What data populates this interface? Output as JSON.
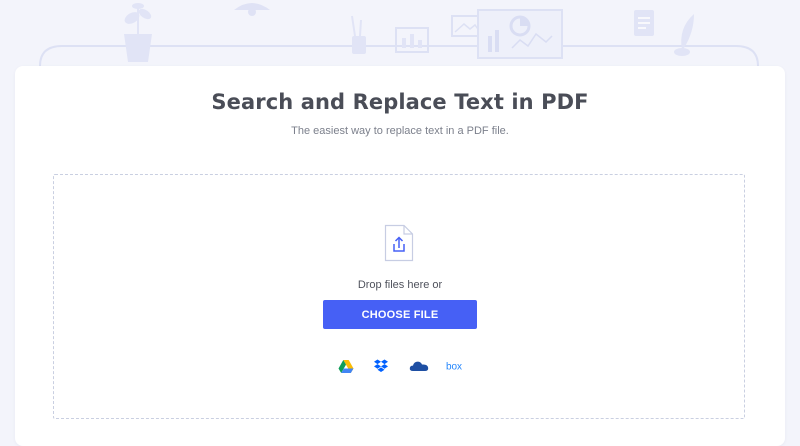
{
  "page": {
    "title": "Search and Replace Text in PDF",
    "subtitle": "The easiest way to replace text in a PDF file."
  },
  "upload": {
    "drop_text": "Drop files here or",
    "choose_button": "CHOOSE FILE",
    "file_icon": "file-upload-icon"
  },
  "cloud_sources": [
    {
      "name": "Google Drive",
      "icon": "google-drive-icon"
    },
    {
      "name": "Dropbox",
      "icon": "dropbox-icon"
    },
    {
      "name": "OneDrive",
      "icon": "onedrive-icon"
    },
    {
      "name": "Box",
      "icon": "box-icon",
      "label": "box"
    }
  ],
  "colors": {
    "accent": "#4660f5",
    "background": "#f3f4fb",
    "illustration": "#e1e4f6",
    "heading": "#4a4d57"
  }
}
